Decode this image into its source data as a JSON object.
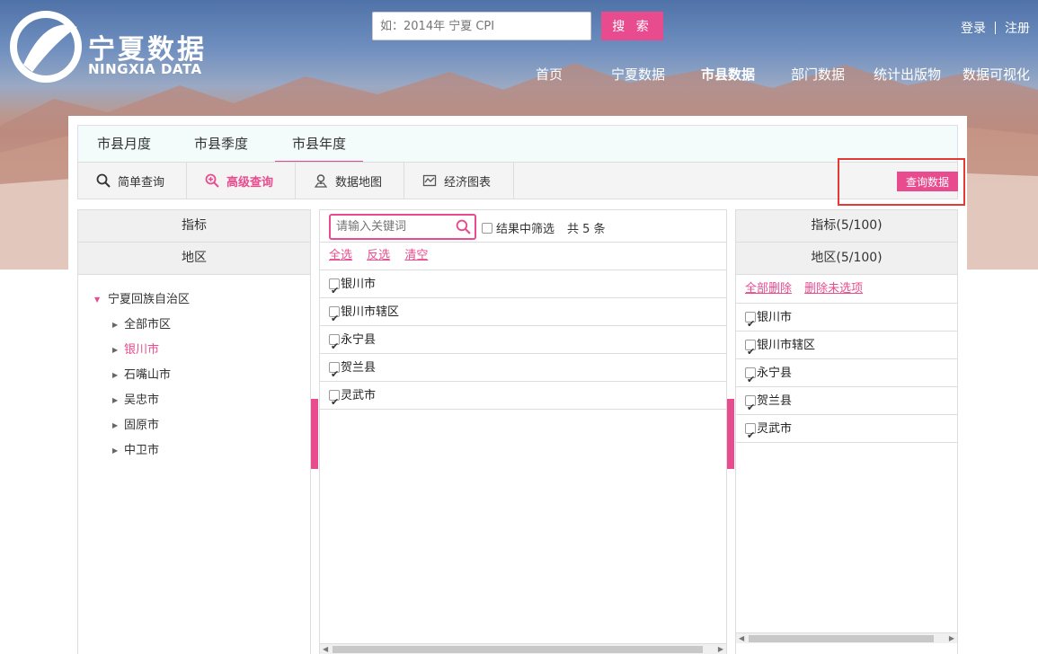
{
  "brand": {
    "name_cn": "宁夏数据",
    "name_en": "NINGXIA DATA"
  },
  "search": {
    "placeholder": "如：2014年 宁夏 CPI",
    "button": "搜 索"
  },
  "auth": {
    "login": "登录",
    "register": "注册"
  },
  "nav": [
    {
      "label": "首页",
      "bold": false
    },
    {
      "label": "宁夏数据",
      "bold": false
    },
    {
      "label": "市县数据",
      "bold": true
    },
    {
      "label": "部门数据",
      "bold": false
    },
    {
      "label": "统计出版物",
      "bold": false
    },
    {
      "label": "数据可视化",
      "bold": false
    }
  ],
  "tabs": [
    "市县月度",
    "市县季度",
    "市县年度"
  ],
  "active_tab": 2,
  "tools": [
    "简单查询",
    "高级查询",
    "数据地图",
    "经济图表"
  ],
  "active_tool": 1,
  "query_button": "查询数据",
  "left": {
    "indicator": "指标",
    "region": "地区",
    "tree": [
      {
        "label": "宁夏回族自治区",
        "level": 0
      },
      {
        "label": "全部市区",
        "level": 1
      },
      {
        "label": "银川市",
        "level": 1,
        "selected": true
      },
      {
        "label": "石嘴山市",
        "level": 1
      },
      {
        "label": "吴忠市",
        "level": 1
      },
      {
        "label": "固原市",
        "level": 1
      },
      {
        "label": "中卫市",
        "level": 1
      }
    ]
  },
  "middle": {
    "keyword_placeholder": "请输入关键词",
    "filter_label": "结果中筛选",
    "count_label": "共 5 条",
    "links": [
      "全选",
      "反选",
      "清空"
    ],
    "items": [
      "银川市",
      "银川市辖区",
      "永宁县",
      "贺兰县",
      "灵武市"
    ]
  },
  "right": {
    "indicator": "指标(5/100)",
    "region": "地区(5/100)",
    "links": [
      "全部删除",
      "删除未选项"
    ],
    "items": [
      "银川市",
      "银川市辖区",
      "永宁县",
      "贺兰县",
      "灵武市"
    ]
  },
  "colors": {
    "accent": "#e84c8f",
    "highlight_box": "#e53935"
  }
}
